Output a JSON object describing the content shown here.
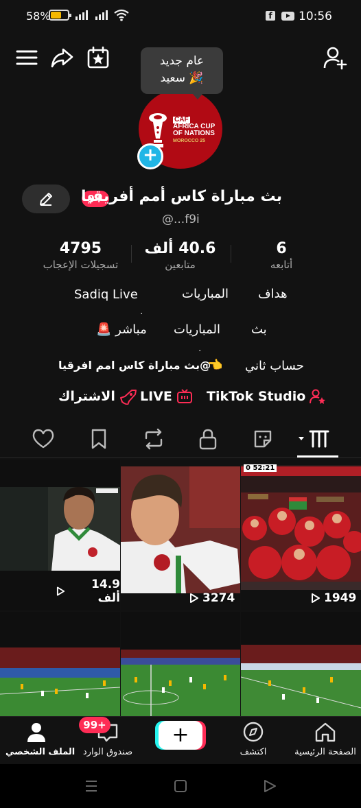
{
  "status_bar": {
    "battery_percent": "58%",
    "battery_level": 0.58,
    "time": "10:56",
    "battery_color": "#f5b800"
  },
  "toolbar": {
    "menu_icon": "hamburger-menu-icon",
    "share_icon": "share-arrow-icon",
    "calendar_icon": "calendar-star-icon",
    "add_friend_icon": "add-user-icon"
  },
  "tooltip": {
    "line1": "عام جديد",
    "line2": "سعيد 🎉"
  },
  "avatar": {
    "logo_caf": "CAF",
    "logo_line1": "AFRICA CUP",
    "logo_line2": "OF NATIONS",
    "logo_line3": "MOROCCO 25",
    "add_symbol": "+"
  },
  "profile": {
    "name": "بث مباراة كاس أمم أفريقيا",
    "notification_badge": "9+",
    "handle": "@...f9i"
  },
  "stats": {
    "following": {
      "value": "6",
      "label": "أتابعه"
    },
    "followers": {
      "value": "40.6 ألف",
      "label": "متابعين"
    },
    "likes": {
      "value": "4795",
      "label": "تسجيلات الإعجاب"
    }
  },
  "bio": {
    "line1_a": "هداف",
    "line1_b": "المباريات",
    "line1_c": "Sadiq Live",
    "dot": ".",
    "line2_a": "بث",
    "line2_b": "المباريات",
    "line2_c": "مباشر 🚨",
    "line3_a": "حساب ثاني",
    "line3_emoji": "👈",
    "line3_b": "@بث مباراة كاس امم افرقيا"
  },
  "links": {
    "studio": "TikTok Studio",
    "live": "LIVE",
    "subscribe": "الاشتراك"
  },
  "tabs": [
    "videos-grid",
    "private-lock",
    "reposts",
    "favorites",
    "liked",
    "stickers"
  ],
  "videos": [
    {
      "views": "1949"
    },
    {
      "views": "3274"
    },
    {
      "views": "14.9 ألف"
    },
    {
      "views": ""
    },
    {
      "views": ""
    },
    {
      "views": ""
    }
  ],
  "video_overlays": {
    "scoreboard": "0 52:21"
  },
  "bottom_nav": {
    "home": "الصفحة الرئيسية",
    "discover": "اكتشف",
    "create": "+",
    "inbox": "صندوق الوارد",
    "inbox_badge": "99+",
    "profile": "الملف الشخصي"
  },
  "colors": {
    "accent_red": "#fe2c55",
    "accent_cyan": "#25f4ee",
    "background": "#121212"
  }
}
